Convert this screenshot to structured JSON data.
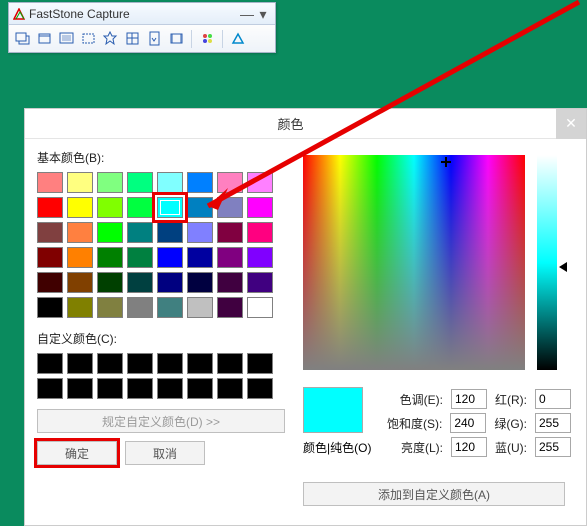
{
  "faststone": {
    "title": "FastStone Capture"
  },
  "dialog": {
    "title": "颜色",
    "basic_label": "基本颜色(B):",
    "custom_label": "自定义颜色(C):",
    "define_btn": "规定自定义颜色(D) >>",
    "ok_btn": "确定",
    "cancel_btn": "取消",
    "preview_label": "颜色|纯色(O)",
    "add_btn": "添加到自定义颜色(A)",
    "hue_label": "色调(E):",
    "sat_label": "饱和度(S):",
    "lum_label": "亮度(L):",
    "r_label": "红(R):",
    "g_label": "绿(G):",
    "b_label": "蓝(U):",
    "hue": "120",
    "sat": "240",
    "lum": "120",
    "r": "0",
    "g": "255",
    "b": "255",
    "basic_colors": [
      "#ff8080",
      "#ffff80",
      "#80ff80",
      "#00ff80",
      "#80ffff",
      "#0080ff",
      "#ff80c0",
      "#ff80ff",
      "#ff0000",
      "#ffff00",
      "#80ff00",
      "#00ff40",
      "#00ffff",
      "#0080c0",
      "#8080c0",
      "#ff00ff",
      "#804040",
      "#ff8040",
      "#00ff00",
      "#008080",
      "#004080",
      "#8080ff",
      "#800040",
      "#ff0080",
      "#800000",
      "#ff8000",
      "#008000",
      "#008040",
      "#0000ff",
      "#0000a0",
      "#800080",
      "#8000ff",
      "#400000",
      "#804000",
      "#004000",
      "#004040",
      "#000080",
      "#000040",
      "#400040",
      "#400080",
      "#000000",
      "#808000",
      "#808040",
      "#808080",
      "#408080",
      "#c0c0c0",
      "#400040",
      "#ffffff"
    ],
    "selected_index": 12,
    "custom_colors": [
      "#000",
      "#000",
      "#000",
      "#000",
      "#000",
      "#000",
      "#000",
      "#000",
      "#000",
      "#000",
      "#000",
      "#000",
      "#000",
      "#000",
      "#000",
      "#000"
    ]
  }
}
